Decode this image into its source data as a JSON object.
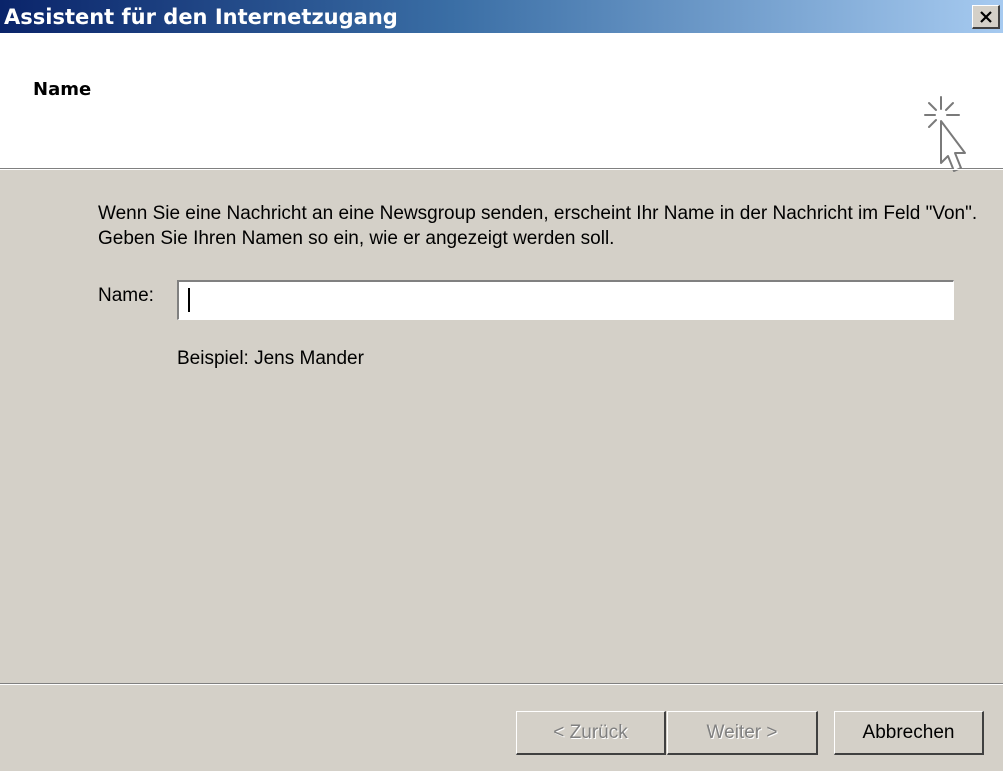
{
  "window": {
    "title": "Assistent für den Internetzugang",
    "close_label": "×"
  },
  "header": {
    "title": "Name",
    "icon": "wizard-cursor-icon"
  },
  "body": {
    "description": "Wenn Sie eine Nachricht an eine Newsgroup senden, erscheint Ihr Name in der Nachricht im Feld \"Von\". Geben Sie Ihren Namen so ein,  wie er angezeigt werden soll.",
    "name_label": "Name:",
    "name_value": "",
    "example": "Beispiel: Jens Mander"
  },
  "buttons": {
    "back": "< Zurück",
    "next": "Weiter >",
    "cancel": "Abbrechen"
  },
  "colors": {
    "title_bar_start": "#0a246a",
    "title_bar_end": "#a6caf0",
    "dialog_face": "#d4d0c8",
    "header_background": "#ffffff",
    "disabled_text": "#808080"
  }
}
